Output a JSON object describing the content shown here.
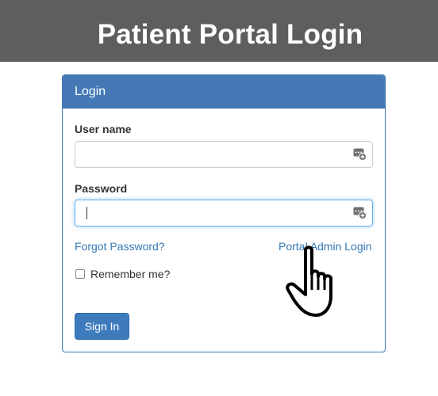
{
  "header": {
    "title": "Patient Portal Login"
  },
  "login_panel": {
    "heading": "Login",
    "username": {
      "label": "User name",
      "value": "",
      "icon": "password-manager-key-icon"
    },
    "password": {
      "label": "Password",
      "value": "",
      "icon": "password-manager-key-icon"
    },
    "forgot_password_link": "Forgot Password?",
    "admin_login_link": "Portal Admin Login",
    "remember_me": {
      "label": "Remember me?",
      "checked": false
    },
    "sign_in_button": "Sign In"
  },
  "colors": {
    "banner": "#5e5e5e",
    "panel_heading": "#4479b6",
    "link": "#3478b5",
    "button": "#3e7bbd"
  },
  "cursor": {
    "type": "hand-pointer",
    "hovering": "admin_login_link"
  }
}
